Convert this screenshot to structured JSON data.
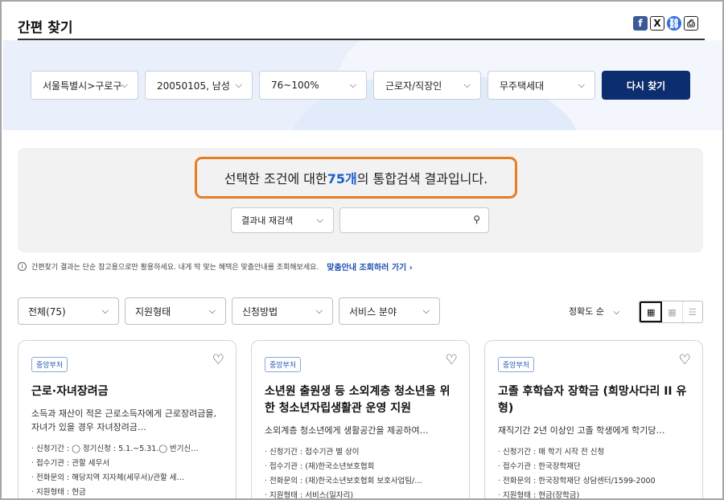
{
  "header": {
    "title": "간편 찾기",
    "share_icons": [
      "facebook-icon",
      "x-icon",
      "link-icon",
      "print-icon"
    ]
  },
  "filters": {
    "region": "서울특별시>구로구",
    "birth_gender": "20050105, 남성",
    "income": "76~100%",
    "job": "근로자/직장인",
    "household": "무주택세대",
    "search_again": "다시 찾기"
  },
  "result": {
    "prefix": "선택한 조건에 대한 ",
    "count": "75개",
    "suffix": "의 통합검색 결과입니다.",
    "inner_search_select": "결과내 재검색",
    "inner_search_value": ""
  },
  "notice": {
    "text": "간편찾기 결과는 단순 참고용으로만 활용하세요. 내게 딱 맞는 혜택은 맞춤안내를 조회해보세요.",
    "link": "맞춤안내 조회하러 가기",
    "link_arrow": "›"
  },
  "list_filters": {
    "all": "전체(75)",
    "support_type": "지원형태",
    "apply_method": "신청방법",
    "service_field": "서비스 분야",
    "sort": "정확도 순"
  },
  "cards": [
    {
      "badge": "중앙부처",
      "title": "근로·자녀장려금",
      "desc": "소득과 재산이 적은 근로소득자에게 근로장려금을,자녀가 있을 경우 자녀장려금…",
      "items": [
        "신청기간 : ◯ 정기신청 : 5.1.~5.31.◯ 반기신…",
        "접수기관 : 관할 세무서",
        "전화문의 : 해당지역 지자체(세무서)/관할 세…",
        "지원형태 : 현금"
      ]
    },
    {
      "badge": "중앙부처",
      "title": "소년원 출원생 등 소외계층 청소년을 위한 청소년자립생활관 운영 지원",
      "desc": "소외계층 청소년에게 생활공간을 제공하여…",
      "items": [
        "신청기간 : 접수기관 별 상이",
        "접수기관 : (재)한국소년보호협회",
        "전화문의 : (재)한국소년보호협회 보호사업팀/…",
        "지원형태 : 서비스(일자리)"
      ]
    },
    {
      "badge": "중앙부처",
      "title": "고졸 후학습자 장학금 (희망사다리 II 유형)",
      "desc": "재직기간 2년 이상인 고졸 학생에게 학기당…",
      "items": [
        "신청기간 : 매 학기 시작 전 신청",
        "접수기관 : 한국장학재단",
        "전화문의 : 한국장학재단 상담센터/1599-2000",
        "지원형태 : 현금(장학금)"
      ]
    }
  ]
}
